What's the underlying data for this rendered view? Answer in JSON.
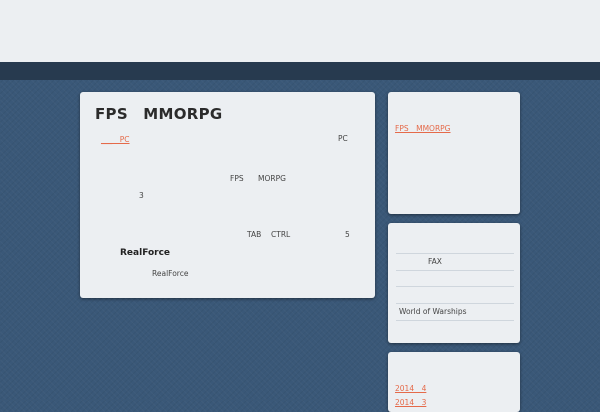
{
  "post": {
    "title": "FPS　MMORPG",
    "link_text": "___　PC",
    "line1_right": "PC",
    "line2_fps": "FPS",
    "line2_mmorpg": "MORPG",
    "line3_num": "3",
    "line4_tab": "TAB",
    "line4_ctrl": "CTRL",
    "line4_num": "5",
    "subheading": "RealForce",
    "subtext": "RealForce"
  },
  "sidebar": {
    "recent_post_link": "FPS　MMORPG",
    "fax_label": "FAX",
    "wow_label": "World of Warships",
    "archive_link_1": "2014　4",
    "archive_link_2": "2014　3"
  },
  "colors": {
    "background": "#3a5878",
    "header": "#eceff2",
    "navbar": "#273a4f",
    "link": "#e56a4a"
  }
}
